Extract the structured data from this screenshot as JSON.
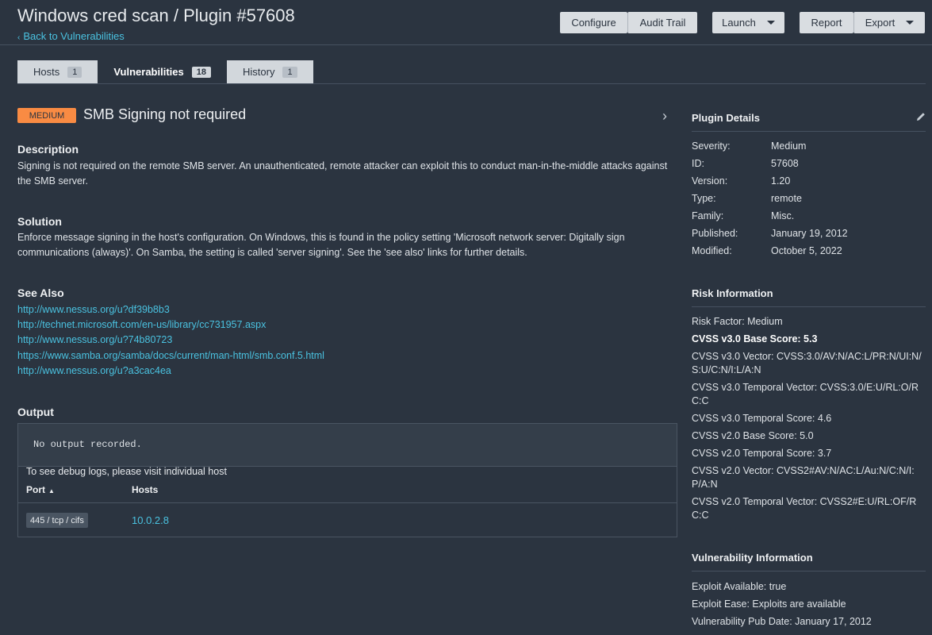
{
  "header": {
    "title": "Windows cred scan / Plugin #57608",
    "back_label": "Back to Vulnerabilities",
    "buttons": {
      "configure": "Configure",
      "audit_trail": "Audit Trail",
      "launch": "Launch",
      "report": "Report",
      "export": "Export"
    }
  },
  "tabs": [
    {
      "label": "Hosts",
      "count": "1"
    },
    {
      "label": "Vulnerabilities",
      "count": "18"
    },
    {
      "label": "History",
      "count": "1"
    }
  ],
  "vuln": {
    "severity": "MEDIUM",
    "title": "SMB Signing not required",
    "description_heading": "Description",
    "description": "Signing is not required on the remote SMB server. An unauthenticated, remote attacker can exploit this to conduct man-in-the-middle attacks against the SMB server.",
    "solution_heading": "Solution",
    "solution": "Enforce message signing in the host's configuration. On Windows, this is found in the policy setting 'Microsoft network server: Digitally sign communications (always)'. On Samba, the setting is called 'server signing'. See the 'see also' links for further details.",
    "see_also_heading": "See Also",
    "see_also": [
      "http://www.nessus.org/u?df39b8b3",
      "http://technet.microsoft.com/en-us/library/cc731957.aspx",
      "http://www.nessus.org/u?74b80723",
      "https://www.samba.org/samba/docs/current/man-html/smb.conf.5.html",
      "http://www.nessus.org/u?a3cac4ea"
    ],
    "output_heading": "Output",
    "output_text": "No output recorded.",
    "debug_note": "To see debug logs, please visit individual host",
    "table_headers": {
      "port": "Port",
      "port_sort": "▲",
      "hosts": "Hosts"
    },
    "rows": [
      {
        "port": "445 / tcp / cifs",
        "host": "10.0.2.8"
      }
    ]
  },
  "plugin_details": {
    "heading": "Plugin Details",
    "rows": [
      {
        "key": "Severity:",
        "value": "Medium"
      },
      {
        "key": "ID:",
        "value": "57608"
      },
      {
        "key": "Version:",
        "value": "1.20"
      },
      {
        "key": "Type:",
        "value": "remote"
      },
      {
        "key": "Family:",
        "value": "Misc."
      },
      {
        "key": "Published:",
        "value": "January 19, 2012"
      },
      {
        "key": "Modified:",
        "value": "October 5, 2022"
      }
    ]
  },
  "risk_info": {
    "heading": "Risk Information",
    "risk_factor": "Risk Factor: Medium",
    "cvss3_base": "CVSS v3.0 Base Score: 5.3",
    "cvss3_vector": "CVSS v3.0 Vector: CVSS:3.0/AV:N/AC:L/PR:N/UI:N/S:U/C:N/I:L/A:N",
    "cvss3_temporal_vector": "CVSS v3.0 Temporal Vector: CVSS:3.0/E:U/RL:O/RC:C",
    "cvss3_temporal_score": "CVSS v3.0 Temporal Score: 4.6",
    "cvss2_base": "CVSS v2.0 Base Score: 5.0",
    "cvss2_temporal_score": "CVSS v2.0 Temporal Score: 3.7",
    "cvss2_vector": "CVSS v2.0 Vector: CVSS2#AV:N/AC:L/Au:N/C:N/I:P/A:N",
    "cvss2_temporal_vector": "CVSS v2.0 Temporal Vector: CVSS2#E:U/RL:OF/RC:C"
  },
  "vuln_info": {
    "heading": "Vulnerability Information",
    "exploit_available": "Exploit Available: true",
    "exploit_ease": "Exploit Ease: Exploits are available",
    "pub_date": "Vulnerability Pub Date: January 17, 2012"
  },
  "colors": {
    "accent": "#4ac2e0",
    "severity_medium": "#f98b43",
    "background": "#2b3440"
  }
}
